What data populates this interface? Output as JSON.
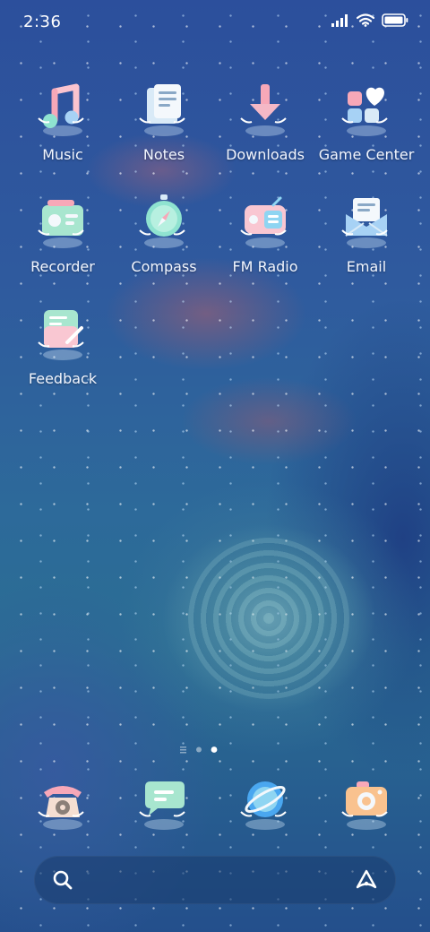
{
  "status_bar": {
    "time": "2:36",
    "signal_icon": "signal-icon",
    "wifi_icon": "wifi-icon",
    "battery_icon": "battery-icon"
  },
  "apps": [
    {
      "label": "Music",
      "icon": "music-icon"
    },
    {
      "label": "Notes",
      "icon": "notes-icon"
    },
    {
      "label": "Downloads",
      "icon": "downloads-icon"
    },
    {
      "label": "Game Center",
      "icon": "game-center-icon"
    },
    {
      "label": "Recorder",
      "icon": "recorder-icon"
    },
    {
      "label": "Compass",
      "icon": "compass-icon"
    },
    {
      "label": "FM Radio",
      "icon": "fm-radio-icon"
    },
    {
      "label": "Email",
      "icon": "email-icon"
    },
    {
      "label": "Feedback",
      "icon": "feedback-icon"
    }
  ],
  "page_indicator": {
    "pages": 2,
    "current": 2
  },
  "dock": [
    {
      "icon": "phone-icon"
    },
    {
      "icon": "messages-icon"
    },
    {
      "icon": "browser-icon"
    },
    {
      "icon": "camera-icon"
    }
  ],
  "search_bar": {
    "left_icon": "search-icon",
    "right_icon": "assistant-icon"
  },
  "colors": {
    "accent_pink": "#f7a8b8",
    "accent_teal": "#8fe3d0",
    "icon_white": "#ffffff"
  }
}
